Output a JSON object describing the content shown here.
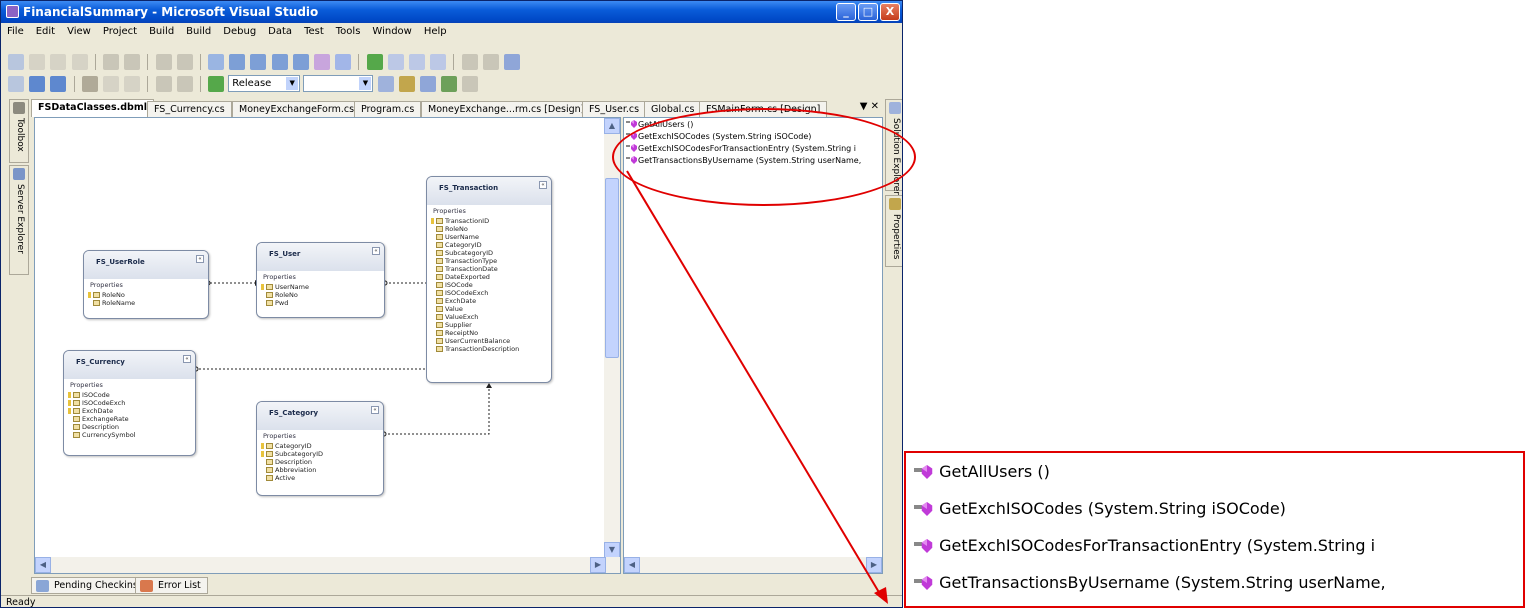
{
  "window": {
    "title": "FinancialSummary - Microsoft Visual Studio",
    "controls": {
      "minimize": "_",
      "maximize": "□",
      "close": "X"
    }
  },
  "menu": [
    "File",
    "Edit",
    "View",
    "Project",
    "Build",
    "Build",
    "Debug",
    "Data",
    "Test",
    "Tools",
    "Window",
    "Help"
  ],
  "toolbar": {
    "configuration": "Release"
  },
  "side_tabs": {
    "toolbox": "Toolbox",
    "server_explorer": "Server Explorer",
    "solution_explorer": "Solution Explorer",
    "properties": "Properties"
  },
  "tabs": [
    "FSDataClasses.dbml",
    "FS_Currency.cs",
    "MoneyExchangeForm.cs",
    "Program.cs",
    "MoneyExchange...rm.cs [Design]",
    "FS_User.cs",
    "Global.cs",
    "FSMainForm.cs [Design]"
  ],
  "tab_controls": {
    "dropdown": "▼",
    "close": "✕"
  },
  "entities": {
    "transaction": {
      "name": "FS_Transaction",
      "section": "Properties",
      "fields": [
        "TransactionID",
        "RoleNo",
        "UserName",
        "CategoryID",
        "SubcategoryID",
        "TransactionType",
        "TransactionDate",
        "DateExported",
        "ISOCode",
        "ISOCodeExch",
        "ExchDate",
        "Value",
        "ValueExch",
        "Supplier",
        "ReceiptNo",
        "UserCurrentBalance",
        "TransactionDescription"
      ]
    },
    "userrole": {
      "name": "FS_UserRole",
      "section": "Properties",
      "fields": [
        "RoleNo",
        "RoleName"
      ]
    },
    "user": {
      "name": "FS_User",
      "section": "Properties",
      "fields": [
        "UserName",
        "RoleNo",
        "Pwd"
      ]
    },
    "currency": {
      "name": "FS_Currency",
      "section": "Properties",
      "fields": [
        "ISOCode",
        "ISOCodeExch",
        "ExchDate",
        "ExchangeRate",
        "Description",
        "CurrencySymbol"
      ]
    },
    "category": {
      "name": "FS_Category",
      "section": "Properties",
      "fields": [
        "CategoryID",
        "SubcategoryID",
        "Description",
        "Abbreviation",
        "Active"
      ]
    }
  },
  "methods": [
    "GetAllUsers ()",
    "GetExchISOCodes (System.String iSOCode)",
    "GetExchISOCodesForTransactionEntry (System.String i",
    "GetTransactionsByUsername (System.String userName,"
  ],
  "bottom_tabs": [
    "Pending Checkins",
    "Error List"
  ],
  "status": "Ready",
  "zoom_methods": [
    "GetAllUsers ()",
    "GetExchISOCodes (System.String iSOCode)",
    "GetExchISOCodesForTransactionEntry (System.String i",
    "GetTransactionsByUsername (System.String userName,"
  ],
  "colors": {
    "callout": "#e00000",
    "titlebar": "#0a5cd9",
    "method_icon": "#c03ad8"
  }
}
